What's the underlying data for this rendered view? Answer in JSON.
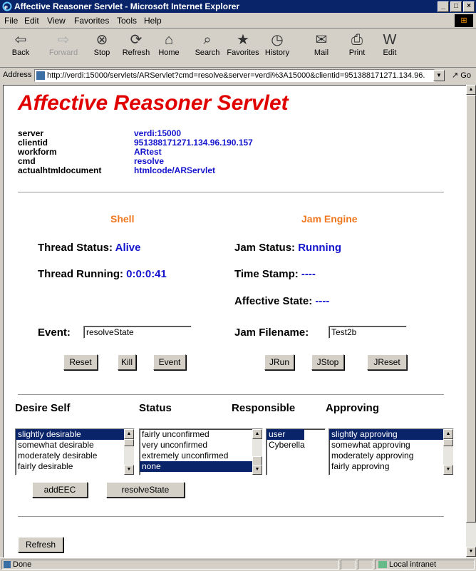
{
  "window": {
    "title": "Affective Reasoner Servlet - Microsoft Internet Explorer",
    "controls": [
      "_",
      "□",
      "×"
    ]
  },
  "menu": [
    "File",
    "Edit",
    "View",
    "Favorites",
    "Tools",
    "Help"
  ],
  "toolbar": {
    "back": "Back",
    "forward": "Forward",
    "stop": "Stop",
    "refresh": "Refresh",
    "home": "Home",
    "search": "Search",
    "favorites": "Favorites",
    "history": "History",
    "mail": "Mail",
    "print": "Print",
    "edit": "Edit"
  },
  "address": {
    "label": "Address",
    "url": "http://verdi:15000/servlets/ARServlet?cmd=resolve&server=verdi%3A15000&clientid=951388171271.134.96.",
    "go": "Go"
  },
  "page": {
    "title": "Affective Reasoner Servlet",
    "info": [
      {
        "key": "server",
        "value": "verdi:15000"
      },
      {
        "key": "clientid",
        "value": "951388171271.134.96.190.157"
      },
      {
        "key": "workform",
        "value": "ARtest"
      },
      {
        "key": "cmd",
        "value": "resolve"
      },
      {
        "key": "actualhtmldocument",
        "value": "htmlcode/ARServlet"
      }
    ],
    "shell": {
      "heading": "Shell",
      "thread_status_label": "Thread Status:",
      "thread_status": "Alive",
      "thread_running_label": "Thread Running:",
      "thread_running": "0:0:0:41",
      "event_label": "Event:",
      "event_value": "resolveState",
      "buttons": {
        "reset": "Reset",
        "kill": "Kill",
        "event": "Event"
      }
    },
    "jam": {
      "heading": "Jam Engine",
      "status_label": "Jam Status:",
      "status": "Running",
      "timestamp_label": "Time Stamp:",
      "timestamp": "----",
      "affective_label": "Affective State:",
      "affective": "----",
      "filename_label": "Jam Filename:",
      "filename_value": "Test2b",
      "buttons": {
        "run": "JRun",
        "stop": "JStop",
        "reset": "JReset"
      }
    },
    "eec": {
      "headers": {
        "desire": "Desire Self",
        "status": "Status",
        "responsible": "Responsible",
        "approving": "Approving"
      },
      "desire_options": [
        "slightly desirable",
        "somewhat desirable",
        "moderately desirable",
        "fairly desirable"
      ],
      "status_options": [
        "fairly unconfirmed",
        "very unconfirmed",
        "extremely unconfirmed",
        "none"
      ],
      "responsible_options": [
        "user",
        "Cyberella"
      ],
      "approving_options": [
        "slightly approving",
        "somewhat approving",
        "moderately approving",
        "fairly approving"
      ],
      "add_button": "addEEC",
      "resolve_button": "resolveState"
    },
    "refresh_button": "Refresh"
  },
  "status": {
    "text": "Done",
    "zone": "Local intranet"
  },
  "colors": {
    "title_red": "#e00000",
    "value_blue": "#1414cc",
    "heading_orange": "#f07820",
    "selection": "#0a246a"
  }
}
